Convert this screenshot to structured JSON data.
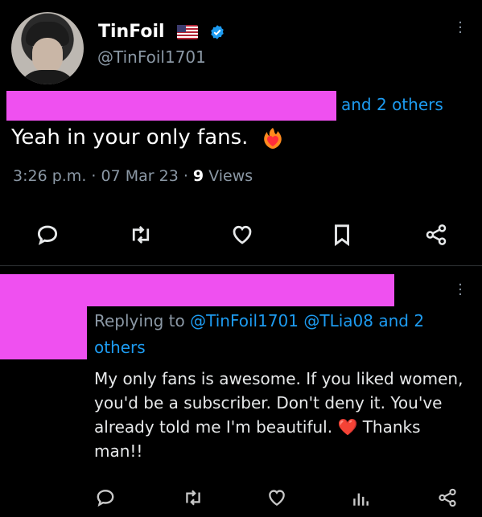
{
  "tweet": {
    "author_name": "TinFoil",
    "author_handle": "@TinFoil1701",
    "mentions_suffix": "and 2 others",
    "text": "Yeah in your only fans.",
    "time": "3:26 p.m.",
    "date_sep": "·",
    "date": "07 Mar 23",
    "views_sep": "·",
    "views_count": "9",
    "views_label": "Views"
  },
  "reply": {
    "replying_to_label": "Replying to",
    "replying_to_handles": "@TinFoil1701 @TLia08 and 2 others",
    "text_before_emoji": "My only fans is awesome. If you liked women, you'd be a subscriber. Don't deny it. You've already told me I'm beautiful.",
    "emoji": "❤️",
    "text_after_emoji": "Thanks man!!"
  },
  "icons": {
    "reply": "reply-icon",
    "retweet": "retweet-icon",
    "like": "heart-icon",
    "bookmark": "bookmark-icon",
    "share": "share-icon",
    "analytics": "analytics-icon",
    "more": "more-icon",
    "verified": "verified-badge-icon",
    "flag": "us-flag-icon",
    "fire_heart": "heart-on-fire-icon"
  },
  "colors": {
    "background": "#000000",
    "text": "#e7e9ea",
    "secondary_text": "#8b98a5",
    "link": "#1d9bf0",
    "redaction": "#ef50f0"
  }
}
